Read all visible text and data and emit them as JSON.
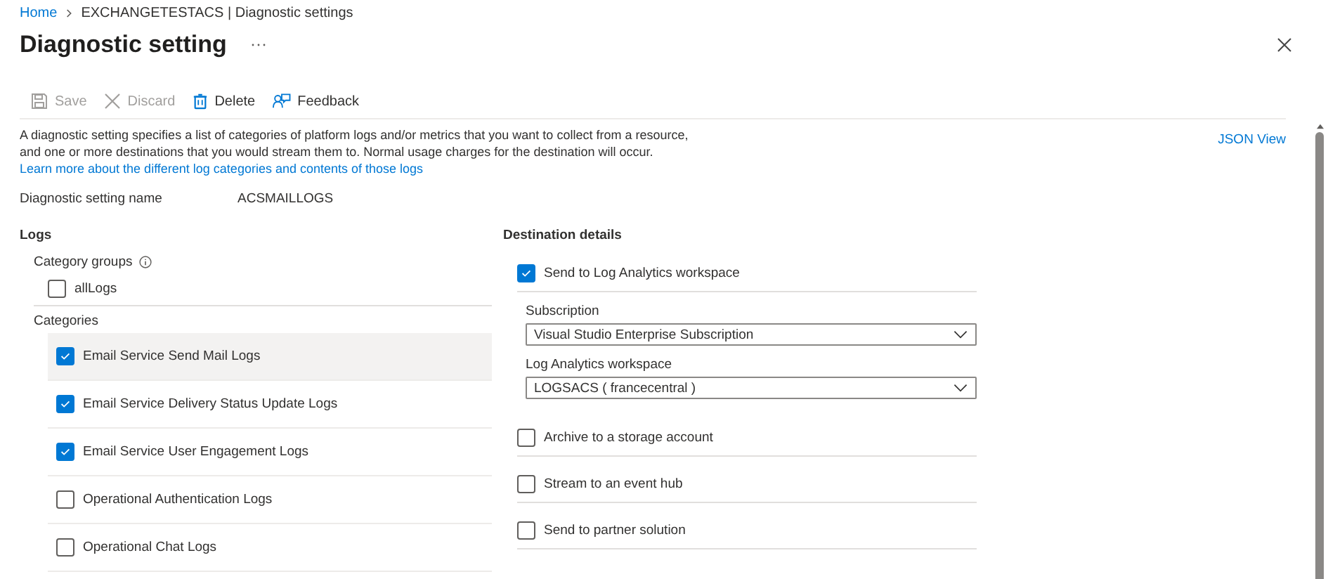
{
  "breadcrumb": [
    "Home",
    "EXCHANGETESTACS | Diagnostic settings"
  ],
  "title": "Diagnostic setting",
  "toolbar": [
    {
      "kind": "save",
      "label": "Save",
      "disabled": true
    },
    {
      "kind": "discard",
      "label": "Discard",
      "disabled": true
    },
    {
      "kind": "delete",
      "label": "Delete",
      "disabled": false
    },
    {
      "kind": "feedback",
      "label": "Feedback",
      "disabled": false
    }
  ],
  "description": {
    "text": "A diagnostic setting specifies a list of categories of platform logs and/or metrics that you want to collect from a resource, and one or more destinations that you would stream them to. Normal usage charges for the destination will occur.",
    "link": "Learn more about the different log categories and contents of those logs"
  },
  "json_view": "JSON View",
  "setting_name": {
    "label": "Diagnostic setting name",
    "value": "ACSMAILLOGS"
  },
  "logs": {
    "heading": "Logs",
    "category_groups": {
      "label": "Category groups",
      "items": [
        {
          "label": "allLogs",
          "checked": false
        }
      ]
    },
    "categories": {
      "label": "Categories",
      "items": [
        {
          "label": "Email Service Send Mail Logs",
          "checked": true,
          "hovered": true
        },
        {
          "label": "Email Service Delivery Status Update Logs",
          "checked": true,
          "hovered": false
        },
        {
          "label": "Email Service User Engagement Logs",
          "checked": true,
          "hovered": false
        },
        {
          "label": "Operational Authentication Logs",
          "checked": false,
          "hovered": false
        },
        {
          "label": "Operational Chat Logs",
          "checked": false,
          "hovered": false
        }
      ]
    }
  },
  "destination": {
    "heading": "Destination details",
    "options": [
      {
        "label": "Send to Log Analytics workspace",
        "checked": true,
        "fields": [
          {
            "label": "Subscription",
            "value": "Visual Studio Enterprise Subscription"
          },
          {
            "label": "Log Analytics workspace",
            "value": "LOGSACS ( francecentral )"
          }
        ]
      },
      {
        "label": "Archive to a storage account",
        "checked": false
      },
      {
        "label": "Stream to an event hub",
        "checked": false
      },
      {
        "label": "Send to partner solution",
        "checked": false
      }
    ]
  }
}
